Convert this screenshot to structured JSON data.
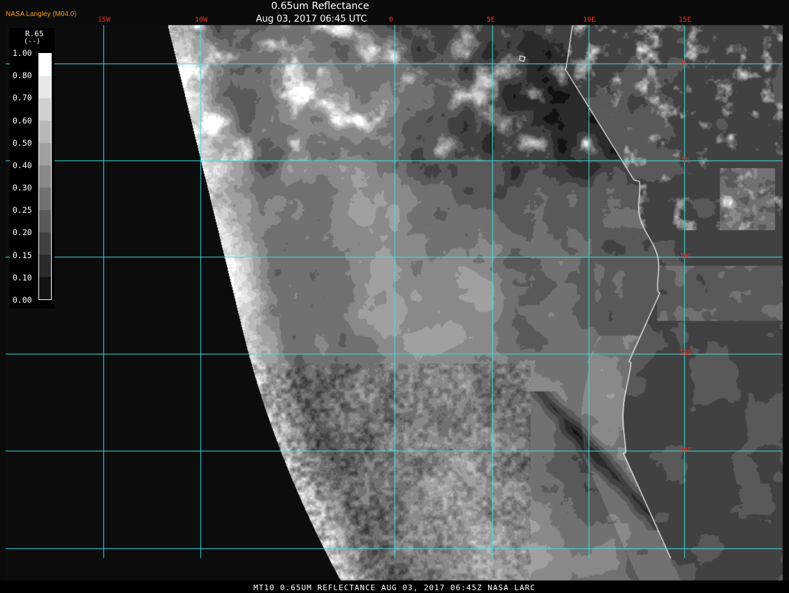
{
  "header": {
    "organization": "NASA Langley (M04.0)",
    "title": "0.65um Reflectance",
    "timestamp": "Aug 03, 2017 06:45 UTC"
  },
  "footer": {
    "caption": "MT10  0.65UM REFLECTANCE   AUG 03, 2017 06:45Z   NASA LARC"
  },
  "colorbar": {
    "variable": "R.65",
    "unit": "(--)",
    "ticks": [
      "1.00",
      "0.80",
      "0.70",
      "0.60",
      "0.50",
      "0.40",
      "0.30",
      "0.25",
      "0.20",
      "0.15",
      "0.10",
      "0.00"
    ],
    "min": 0.0,
    "max": 1.0
  },
  "map": {
    "region": "Southeast Atlantic / Southwest Africa",
    "lon_labels": [
      "15W",
      "10W",
      "0",
      "5E",
      "10E",
      "15E"
    ],
    "lat_labels": [
      "0",
      "5S",
      "10S",
      "15S",
      "20S"
    ],
    "grid_color": "#3fe0e6",
    "label_color": "#e8301e",
    "coastline_color": "#ffffff"
  }
}
